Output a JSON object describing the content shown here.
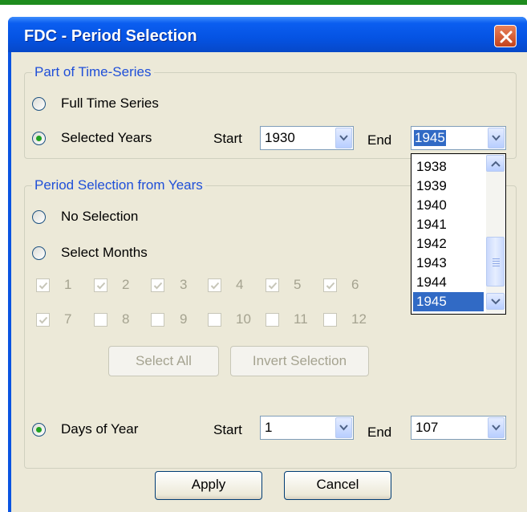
{
  "window": {
    "title": "FDC - Period Selection"
  },
  "part_of_time_series": {
    "legend": "Part of Time-Series",
    "full_time_series_label": "Full Time Series",
    "selected_years_label": "Selected Years",
    "selected": "selected_years",
    "start_label": "Start",
    "start_value": "1930",
    "end_label": "End",
    "end_value": "1945",
    "end_dropdown_items": [
      "1938",
      "1939",
      "1940",
      "1941",
      "1942",
      "1943",
      "1944",
      "1945"
    ],
    "end_dropdown_selected": "1945"
  },
  "period_selection": {
    "legend": "Period Selection from Years",
    "no_selection_label": "No Selection",
    "select_months_label": "Select Months",
    "days_of_year_label": "Days of Year",
    "selected": "days_of_year",
    "months": [
      {
        "label": "1",
        "checked": true
      },
      {
        "label": "2",
        "checked": true
      },
      {
        "label": "3",
        "checked": true
      },
      {
        "label": "4",
        "checked": true
      },
      {
        "label": "5",
        "checked": true
      },
      {
        "label": "6",
        "checked": true
      },
      {
        "label": "7",
        "checked": true
      },
      {
        "label": "8",
        "checked": false
      },
      {
        "label": "9",
        "checked": false
      },
      {
        "label": "10",
        "checked": false
      },
      {
        "label": "11",
        "checked": false
      },
      {
        "label": "12",
        "checked": false
      }
    ],
    "select_all_label": "Select All",
    "invert_selection_label": "Invert Selection",
    "days_start_label": "Start",
    "days_start_value": "1",
    "days_end_label": "End",
    "days_end_value": "107"
  },
  "footer": {
    "apply_label": "Apply",
    "cancel_label": "Cancel"
  },
  "icons": {
    "close": "close-icon",
    "dropdown": "chevron-down-icon",
    "check": "checkmark-icon"
  },
  "colors": {
    "title_bar": "#0553e3",
    "close_button": "#c4421c",
    "legend_text": "#1f4fd8",
    "radio_dot": "#21a121",
    "selection": "#316ac5",
    "face": "#ece9d8"
  }
}
